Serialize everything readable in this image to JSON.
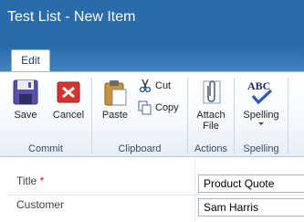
{
  "window": {
    "title": "Test List - New Item"
  },
  "ribbon": {
    "tabs": [
      {
        "label": "Edit"
      }
    ],
    "groups": {
      "commit": {
        "label": "Commit",
        "save": "Save",
        "cancel": "Cancel"
      },
      "clipboard": {
        "label": "Clipboard",
        "paste": "Paste",
        "cut": "Cut",
        "copy": "Copy"
      },
      "actions": {
        "label": "Actions",
        "attach_line1": "Attach",
        "attach_line2": "File"
      },
      "spelling": {
        "label": "Spelling",
        "spelling": "Spelling"
      }
    }
  },
  "form": {
    "fields": [
      {
        "label": "Title",
        "required_marker": "*",
        "value": "Product Quote"
      },
      {
        "label": "Customer",
        "value": "Sam Harris"
      }
    ]
  }
}
